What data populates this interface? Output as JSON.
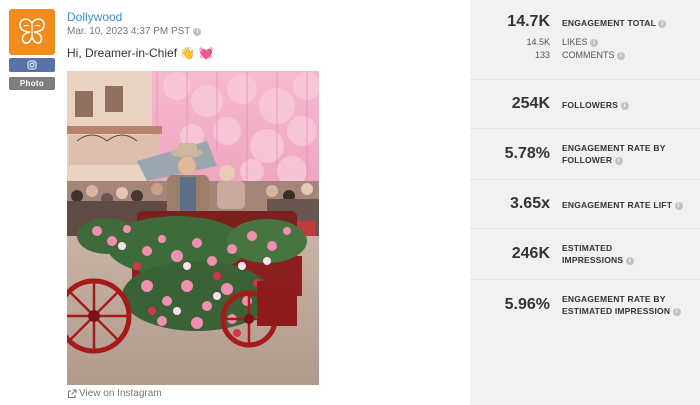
{
  "post": {
    "account_name": "Dollywood",
    "date": "Mar. 10, 2023 4:37 PM PST",
    "caption": "Hi, Dreamer-in-Chief 👋 💓",
    "network": "instagram",
    "post_type": "Photo",
    "view_link": "View on Instagram",
    "icons": {
      "avatar": "butterfly-logo-icon",
      "network": "instagram-icon",
      "link": "external-link-icon",
      "info": "info-icon"
    },
    "colors": {
      "brand": "#f28a1c",
      "network_badge": "#5873a8",
      "link": "#3a8fd1"
    }
  },
  "stats": {
    "engagement_total": {
      "value": "14.7K",
      "label": "ENGAGEMENT TOTAL"
    },
    "likes": {
      "value": "14.5K",
      "label": "LIKES"
    },
    "comments": {
      "value": "133",
      "label": "COMMENTS"
    },
    "followers": {
      "value": "254K",
      "label": "FOLLOWERS"
    },
    "engagement_rate_follower": {
      "value": "5.78%",
      "label_line1": "ENGAGEMENT RATE BY",
      "label_line2": "FOLLOWER"
    },
    "engagement_rate_lift": {
      "value": "3.65x",
      "label": "ENGAGEMENT RATE LIFT"
    },
    "estimated_impressions": {
      "value": "246K",
      "label_line1": "ESTIMATED",
      "label_line2": "IMPRESSIONS"
    },
    "engagement_rate_impression": {
      "value": "5.96%",
      "label_line1": "ENGAGEMENT RATE BY",
      "label_line2": "ESTIMATED IMPRESSION"
    }
  }
}
